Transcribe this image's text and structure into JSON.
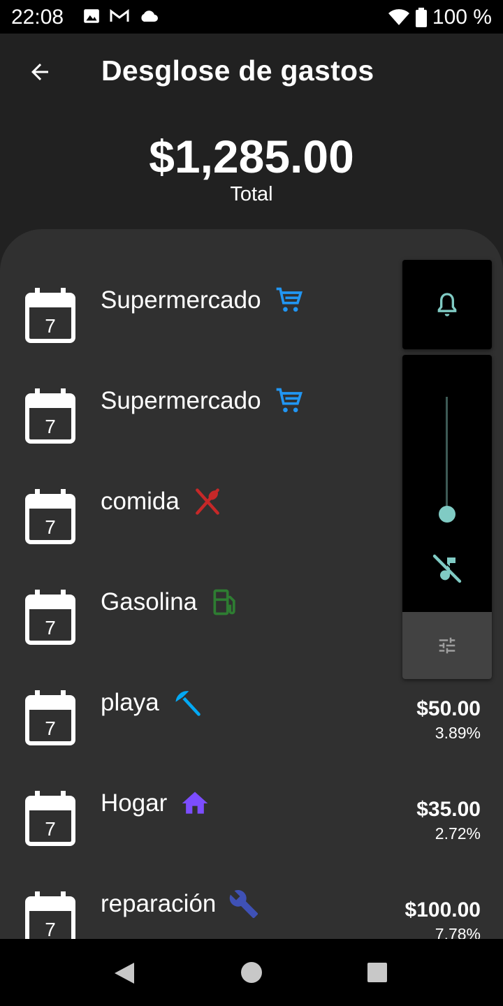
{
  "status_bar": {
    "time": "22:08",
    "battery": "100 %",
    "icons": [
      "image-icon",
      "gmail-icon",
      "cloud-icon",
      "wifi-icon",
      "battery-icon"
    ]
  },
  "header": {
    "title": "Desglose de gastos",
    "back_icon": "arrow-back-icon"
  },
  "summary": {
    "total": "$1,285.00",
    "total_label": "Total"
  },
  "expenses": [
    {
      "day": "7",
      "name": "Supermercado",
      "icon": "cart-icon",
      "icon_color": "#2196f3",
      "amount": "$",
      "percent": ""
    },
    {
      "day": "7",
      "name": "Supermercado",
      "icon": "cart-icon",
      "icon_color": "#2196f3",
      "amount": "$",
      "percent": ""
    },
    {
      "day": "7",
      "name": "comida",
      "icon": "utensils-icon",
      "icon_color": "#c62828",
      "amount": "",
      "percent": ""
    },
    {
      "day": "7",
      "name": "Gasolina",
      "icon": "gas-station-icon",
      "icon_color": "#2e7d32",
      "amount": "",
      "percent": ""
    },
    {
      "day": "7",
      "name": "playa",
      "icon": "beach-umbrella-icon",
      "icon_color": "#03a9f4",
      "amount": "$50.00",
      "percent": "3.89%"
    },
    {
      "day": "7",
      "name": "Hogar",
      "icon": "home-icon",
      "icon_color": "#7c4dff",
      "amount": "$35.00",
      "percent": "2.72%"
    },
    {
      "day": "7",
      "name": "reparación",
      "icon": "wrench-icon",
      "icon_color": "#3f51b5",
      "amount": "$100.00",
      "percent": "7.78%"
    }
  ],
  "volume_overlay": {
    "bell_icon": "bell-icon",
    "mute_icon": "music-off-icon",
    "settings_icon": "tune-icon",
    "level_fraction": 0.0,
    "accent": "#80cbc4"
  },
  "nav_bar": {
    "icons": [
      "nav-back-icon",
      "nav-home-icon",
      "nav-recents-icon"
    ]
  },
  "colors": {
    "background": "#212121",
    "sheet": "#303030",
    "text": "#ffffff"
  }
}
